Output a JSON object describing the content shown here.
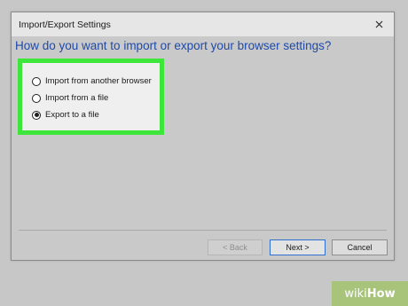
{
  "dialog": {
    "title": "Import/Export Settings",
    "close_glyph": "×",
    "header": "How do you want to import or export your browser settings?"
  },
  "options": [
    {
      "label": "Import from another browser",
      "selected": false
    },
    {
      "label": "Import from a file",
      "selected": false
    },
    {
      "label": "Export to a file",
      "selected": true
    }
  ],
  "buttons": {
    "back": "< Back",
    "next": "Next >",
    "cancel": "Cancel"
  },
  "watermark": {
    "part1": "wiki",
    "part2": "How"
  },
  "colors": {
    "header_text": "#1f4aa8",
    "highlight_border": "#3ee53a",
    "watermark_bg": "#a8c47a"
  }
}
